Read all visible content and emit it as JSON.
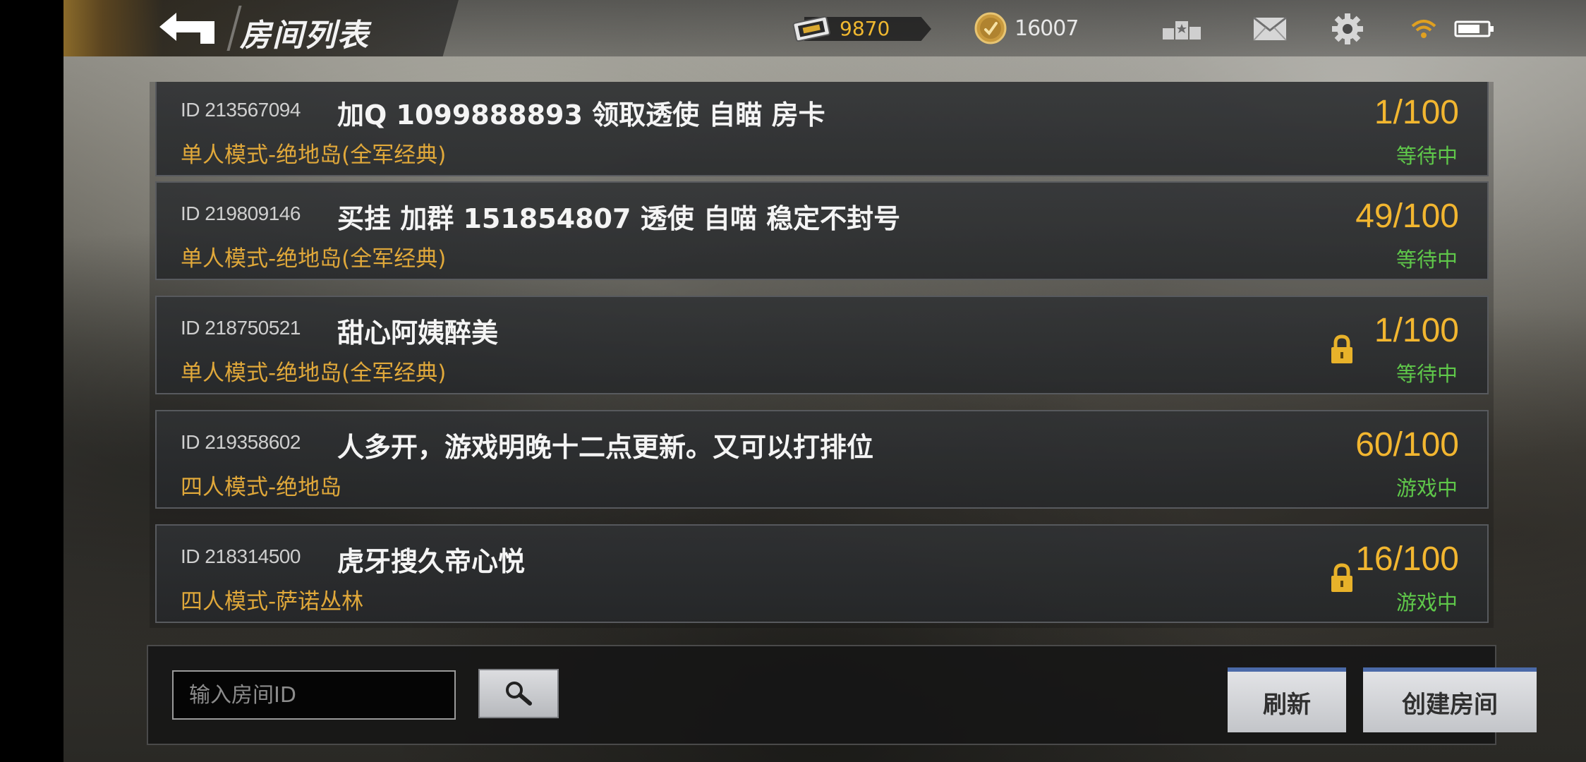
{
  "header": {
    "title": "房间列表",
    "ticket_value": "9870",
    "coin_value": "16007",
    "icons": [
      "back-arrow-icon",
      "ticket-icon",
      "coin-icon",
      "rank-icon",
      "mail-icon",
      "gear-icon",
      "wifi-icon",
      "battery-icon"
    ]
  },
  "rooms": [
    {
      "id": "ID 213567094",
      "name": "加Q 1099888893 领取透使 自瞄 房卡",
      "mode": "单人模式-绝地岛(全军经典)",
      "count": "1/100",
      "status": "等待中",
      "locked": false
    },
    {
      "id": "ID 219809146",
      "name": "买挂 加群 151854807 透使 自喵 稳定不封号",
      "mode": "单人模式-绝地岛(全军经典)",
      "count": "49/100",
      "status": "等待中",
      "locked": false
    },
    {
      "id": "ID 218750521",
      "name": "甜心阿姨醉美",
      "mode": "单人模式-绝地岛(全军经典)",
      "count": "1/100",
      "status": "等待中",
      "locked": true
    },
    {
      "id": "ID 219358602",
      "name": "人多开，游戏明晚十二点更新。又可以打排位",
      "mode": "四人模式-绝地岛",
      "count": "60/100",
      "status": "游戏中",
      "locked": false
    },
    {
      "id": "ID 218314500",
      "name": "虎牙搜久帝心悦",
      "mode": "四人模式-萨诺丛林",
      "count": "16/100",
      "status": "游戏中",
      "locked": true
    }
  ],
  "footer": {
    "search_placeholder": "输入房间ID",
    "refresh_label": "刷新",
    "create_room_label": "创建房间"
  },
  "colors": {
    "accent_gold": "#f2b630",
    "mode_orange": "#e0a83a",
    "status_green": "#5fc84a",
    "button_blue_top": "#4b6aa8"
  }
}
